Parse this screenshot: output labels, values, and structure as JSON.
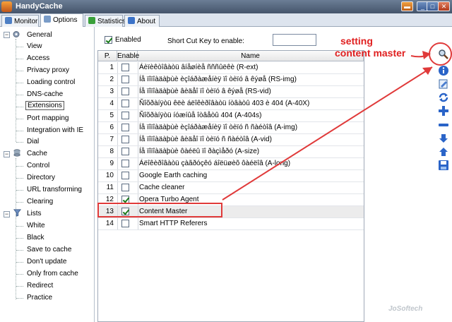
{
  "window": {
    "title": "HandyCache"
  },
  "tabs": [
    {
      "label": "Monitor",
      "active": false
    },
    {
      "label": "Options",
      "active": true
    },
    {
      "label": "Statistics",
      "active": false
    },
    {
      "label": "About",
      "active": false
    }
  ],
  "tree": {
    "general": {
      "label": "General",
      "children": [
        "View",
        "Access",
        "Privacy proxy",
        "Loading control",
        "DNS-cache",
        "Extensions",
        "Port mapping",
        "Integration with IE",
        "Dial"
      ]
    },
    "cache": {
      "label": "Cache",
      "children": [
        "Control",
        "Directory",
        "URL transforming",
        "Clearing"
      ]
    },
    "lists": {
      "label": "Lists",
      "children": [
        "White",
        "Black",
        "Save to cache",
        "Don't update",
        "Only from cache",
        "Redirect",
        "Practice"
      ]
    },
    "selected": "Extensions"
  },
  "panel": {
    "enabled_label": "Enabled",
    "enabled_checked": true,
    "shortcut_label": "Short Cut Key to enable:",
    "shortcut_value": ""
  },
  "grid": {
    "headers": [
      "P.",
      "Enable",
      "Name"
    ],
    "rows": [
      {
        "num": "1",
        "enabled": false,
        "name": "Áèïèêòîâàòü âíåøíèå ñññûëêè (R-ext)"
      },
      {
        "num": "2",
        "enabled": false,
        "name": "Íå ïîïîàäàþùè èçîáðàæåíèÿ ïî òèïó â êýøå (RS-img)"
      },
      {
        "num": "3",
        "enabled": false,
        "name": "Íå ïîïîàäàþùè âèäåî ïî òèïó â êýøå (RS-vid)"
      },
      {
        "num": "4",
        "enabled": false,
        "name": "Ñîõðàíÿòü êëè áëîêèðîâàòü íòâàòû 403 è 404 (A-40X)"
      },
      {
        "num": "5",
        "enabled": false,
        "name": "Ñîõðàíÿòü íóæíûå îòâåòû 404 (A-404s)"
      },
      {
        "num": "6",
        "enabled": false,
        "name": "Íå ïîïîàäàþùè èçîáðàæåíèÿ ïî òèïó ñ ñàéòîâ (A-img)"
      },
      {
        "num": "7",
        "enabled": false,
        "name": "Íå ïîïîàäàþùè âèäåî ïî òèïó ñ ñàéòîâ (A-vid)"
      },
      {
        "num": "8",
        "enabled": false,
        "name": "Íå ïîïîàäàþùè ôàéëû ïî ðàçìåðó (A-size)"
      },
      {
        "num": "9",
        "enabled": false,
        "name": "Áëîêèðîâàòü çàãðóçêó áîëüøèõ ôàéëîâ (A-long)"
      },
      {
        "num": "10",
        "enabled": false,
        "name": "Google Earth caching"
      },
      {
        "num": "11",
        "enabled": false,
        "name": "Cache cleaner"
      },
      {
        "num": "12",
        "enabled": true,
        "name": "Opera Turbo Agent"
      },
      {
        "num": "13",
        "enabled": true,
        "name": "Content Master"
      },
      {
        "num": "14",
        "enabled": false,
        "name": "Smart HTTP Referers"
      }
    ]
  },
  "annotation": {
    "line1": "setting",
    "line2": "content master"
  },
  "watermark": "JoSoftech",
  "colors": {
    "annotation": "#e02020",
    "titlebar": "#45556b",
    "highlight_row": "#ececec"
  },
  "right_toolbar_icons": [
    "search-icon",
    "info-icon",
    "edit-icon",
    "refresh-icon",
    "add-icon",
    "remove-icon",
    "move-down-icon",
    "move-up-icon",
    "save-icon"
  ]
}
